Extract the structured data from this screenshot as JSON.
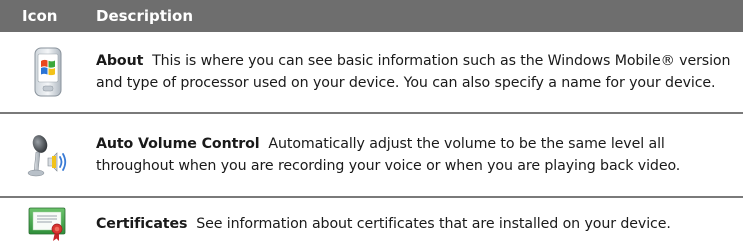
{
  "header": {
    "icon_label": "Icon",
    "description_label": "Description"
  },
  "rows": [
    {
      "icon": "about-device-icon",
      "name": "About",
      "text": "This is where you can see basic information such as the Windows Mobile® version and type of processor used on your device. You can also specify a name for your device."
    },
    {
      "icon": "microphone-speaker-icon",
      "name": "Auto Volume Control",
      "text": "Automatically adjust the volume to be the same level all throughout when you are recording your voice or when you are playing back video."
    },
    {
      "icon": "certificate-icon",
      "name": "Certificates",
      "text": "See information about certificates that are installed on your device."
    }
  ]
}
